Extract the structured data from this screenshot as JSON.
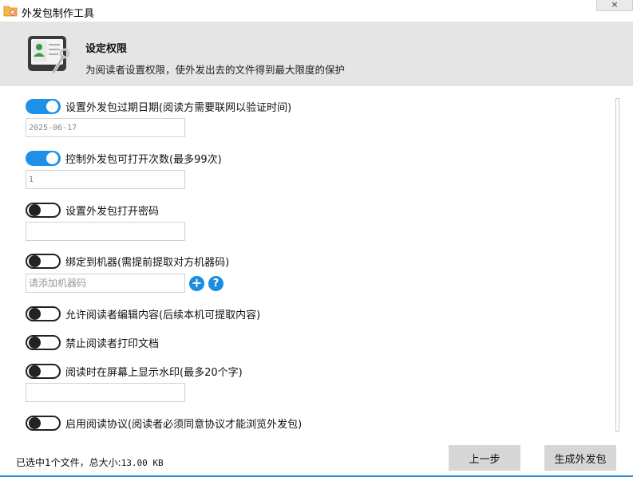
{
  "window": {
    "title": "外发包制作工具",
    "close_label": "×"
  },
  "banner": {
    "heading": "设定权限",
    "description": "为阅读者设置权限，使外发出去的文件得到最大限度的保护"
  },
  "options": {
    "expiry": {
      "label": "设置外发包过期日期(阅读方需要联网以验证时间)",
      "enabled": true,
      "value": "2025-06-17"
    },
    "open_count": {
      "label": "控制外发包可打开次数(最多99次)",
      "enabled": true,
      "value": "1"
    },
    "password": {
      "label": "设置外发包打开密码",
      "enabled": false,
      "value": ""
    },
    "bind_machine": {
      "label": "绑定到机器(需提前提取对方机器码)",
      "enabled": false,
      "placeholder": "请添加机器码"
    },
    "allow_edit": {
      "label": "允许阅读者编辑内容(后续本机可提取内容)",
      "enabled": false
    },
    "no_print": {
      "label": "禁止阅读者打印文档",
      "enabled": false
    },
    "watermark": {
      "label": "阅读时在屏幕上显示水印(最多20个字)",
      "enabled": false,
      "value": ""
    },
    "reading_agreement": {
      "label": "启用阅读协议(阅读者必须同意协议才能浏览外发包)",
      "enabled": false
    }
  },
  "status": {
    "prefix": "已选中1个文件，总大小:",
    "size": "13.00 KB"
  },
  "buttons": {
    "prev": "上一步",
    "generate": "生成外发包"
  },
  "colors": {
    "accent": "#1e90e8",
    "banner_bg": "#e5e5e5",
    "button_bg": "#d6d6d6"
  }
}
